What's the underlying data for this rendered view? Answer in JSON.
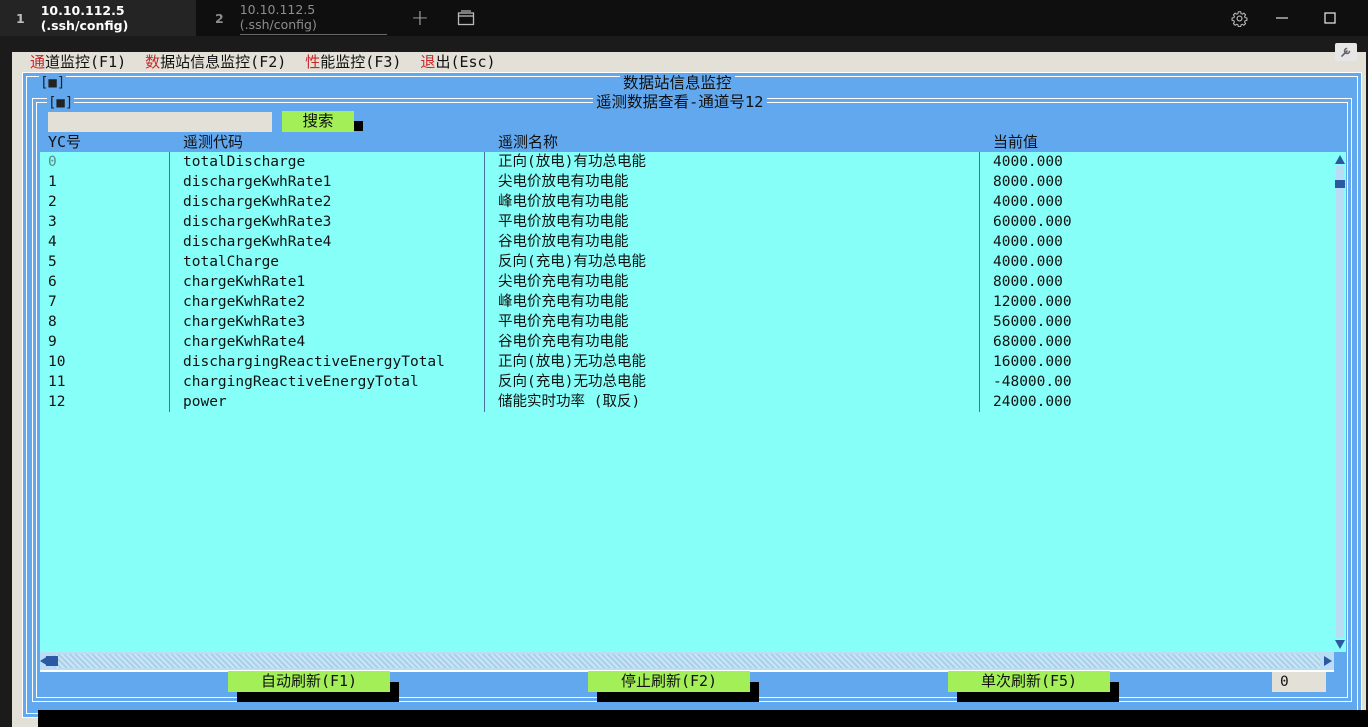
{
  "tabs": [
    {
      "num": "1",
      "label": "10.10.112.5 (.ssh/config)"
    },
    {
      "num": "2",
      "label": "10.10.112.5 (.ssh/config)"
    }
  ],
  "titlebar_icons": [
    "plus-icon",
    "window-icon",
    "gear-icon",
    "minimize-icon",
    "maximize-icon"
  ],
  "menu": [
    {
      "hot": "通",
      "rest": "道监控(F1)"
    },
    {
      "hot": "数",
      "rest": "据站信息监控(F2)"
    },
    {
      "hot": "性",
      "rest": "能监控(F3)"
    },
    {
      "hot": "退",
      "rest": "出(Esc)"
    }
  ],
  "outer": {
    "close_label": "[■]",
    "title": "数据站信息监控"
  },
  "inner": {
    "close_label": "[■]",
    "title": "遥测数据查看-通道号12"
  },
  "search": {
    "value": "",
    "button_label": "搜索"
  },
  "table": {
    "headers": [
      "YC号",
      "遥测代码",
      "遥测名称",
      "当前值"
    ],
    "rows": [
      [
        "0",
        "totalDischarge",
        "正向(放电)有功总电能",
        "4000.000"
      ],
      [
        "1",
        "dischargeKwhRate1",
        "尖电价放电有功电能",
        "8000.000"
      ],
      [
        "2",
        "dischargeKwhRate2",
        "峰电价放电有功电能",
        "4000.000"
      ],
      [
        "3",
        "dischargeKwhRate3",
        "平电价放电有功电能",
        "60000.000"
      ],
      [
        "4",
        "dischargeKwhRate4",
        "谷电价放电有功电能",
        "4000.000"
      ],
      [
        "5",
        "totalCharge",
        "反向(充电)有功总电能",
        "4000.000"
      ],
      [
        "6",
        "chargeKwhRate1",
        "尖电价充电有功电能",
        "8000.000"
      ],
      [
        "7",
        "chargeKwhRate2",
        "峰电价充电有功电能",
        "12000.000"
      ],
      [
        "8",
        "chargeKwhRate3",
        "平电价充电有功电能",
        "56000.000"
      ],
      [
        "9",
        "chargeKwhRate4",
        "谷电价充电有功电能",
        "68000.000"
      ],
      [
        "10",
        "dischargingReactiveEnergyTotal",
        "正向(放电)无功总电能",
        "16000.000"
      ],
      [
        "11",
        "chargingReactiveEnergyTotal",
        "反向(充电)无功总电能",
        "-48000.00"
      ],
      [
        "12",
        "power",
        "储能实时功率 (取反)",
        "24000.000"
      ]
    ],
    "selected_row": 0
  },
  "buttons": {
    "auto_refresh": "自动刷新(F1)",
    "stop_refresh": "停止刷新(F2)",
    "single_refresh": "单次刷新(F5)"
  },
  "counter": "0",
  "colors": {
    "frame": "#62a8ef",
    "table": "#86fff8",
    "button": "#a2ef58",
    "hotkey": "#c82828",
    "selected_text": "#5a8a86"
  }
}
